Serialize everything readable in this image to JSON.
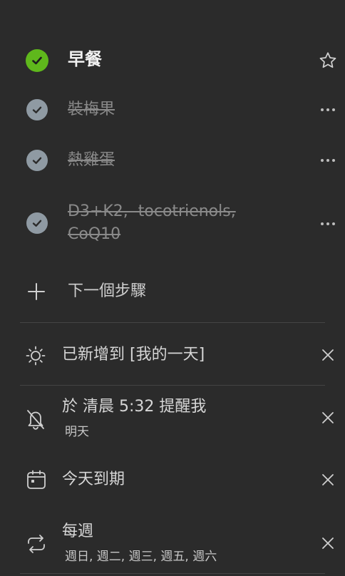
{
  "task": {
    "title": "早餐",
    "completed": true,
    "check_color": "#5fb81c",
    "star_icon": "star-outline-icon"
  },
  "steps": [
    {
      "label": "裝梅果",
      "completed": true
    },
    {
      "label": "熱雞蛋",
      "completed": true
    },
    {
      "label_line1": "D3+K2,  tocotrienols,",
      "label_line2": "CoQ10",
      "completed": true
    }
  ],
  "add_step": {
    "label": "下一個步驟",
    "icon": "plus-icon"
  },
  "my_day": {
    "label": "已新增到 [我的一天]",
    "icon": "sun-icon"
  },
  "reminder": {
    "label": "於 清晨 5:32 提醒我",
    "sub": "明天",
    "icon": "bell-off-icon"
  },
  "due": {
    "label": "今天到期",
    "icon": "calendar-icon"
  },
  "repeat": {
    "label": "每週",
    "sub": "週日, 週二, 週三, 週五, 週六",
    "icon": "repeat-icon"
  },
  "colors": {
    "background": "#2b2b2b",
    "accent_green": "#5fb81c",
    "step_check": "#8f9aa3",
    "divider": "#444444"
  }
}
